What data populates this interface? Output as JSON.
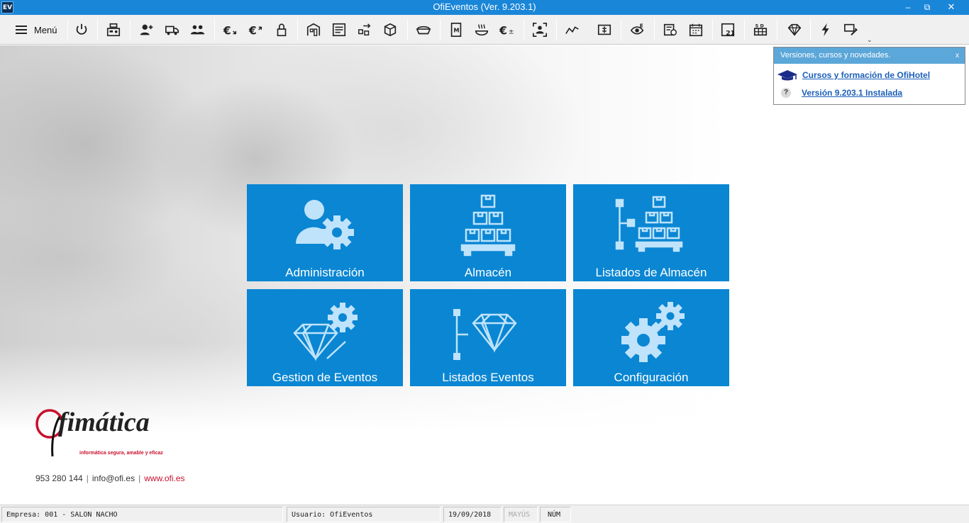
{
  "window": {
    "app_badge": "EV",
    "title": "OfiEventos (Ver. 9.203.1)",
    "controls": {
      "minimize": "–",
      "restore": "⧉",
      "close": "✕"
    }
  },
  "toolbar": {
    "menu_label": "Menú",
    "icons": [
      "power-icon",
      "cash-register-icon",
      "user-add-icon",
      "delivery-truck-icon",
      "users-icon",
      "euro-in-icon",
      "euro-out-icon",
      "lock-icon",
      "building-icon",
      "storefront-icon",
      "transfer-icon",
      "box-icon",
      "tray-icon",
      "menu-card-icon",
      "hot-dish-icon",
      "euro-plus-minus-icon",
      "person-target-icon",
      "trend-chart-icon",
      "scale-icon",
      "eye-e-icon",
      "invoice-icon",
      "calendar-icon",
      "calendar-21-icon",
      "schedule-sd-icon",
      "diamond-tag-icon",
      "lightning-icon",
      "wrench-icon"
    ],
    "more_glyph": "⌄"
  },
  "news": {
    "header": "Versiones, cursos y novedades.",
    "close": "x",
    "courses_link": "Cursos y formación de OfiHotel",
    "version_icon": "?",
    "version_link": "Versión 9.203.1 Instalada"
  },
  "tiles": [
    {
      "label": "Administración",
      "icon": "admin-user-gear-icon"
    },
    {
      "label": "Almacén",
      "icon": "warehouse-boxes-icon"
    },
    {
      "label": "Listados de Almacén",
      "icon": "warehouse-list-icon"
    },
    {
      "label": "Gestion de Eventos",
      "icon": "diamond-gear-icon"
    },
    {
      "label": "Listados Eventos",
      "icon": "diamond-list-icon"
    },
    {
      "label": "Configuración",
      "icon": "gears-icon"
    }
  ],
  "logo": {
    "brand": "fimática",
    "tagline": "informática segura, amable y eficaz"
  },
  "contact": {
    "phone": "953 280 144",
    "email": "info@ofi.es",
    "web": "www.ofi.es",
    "separator": "|"
  },
  "status": {
    "company": "Empresa: 001 - SALON NACHO",
    "user": "Usuario: OfiEventos",
    "date": "19/09/2018",
    "caps": "MAYÚS",
    "num": "NÚM"
  },
  "colors": {
    "titlebar": "#1a86d8",
    "tile": "#0a86d3",
    "tile_icon": "#bfe3fb",
    "brand_red": "#c8102e"
  }
}
